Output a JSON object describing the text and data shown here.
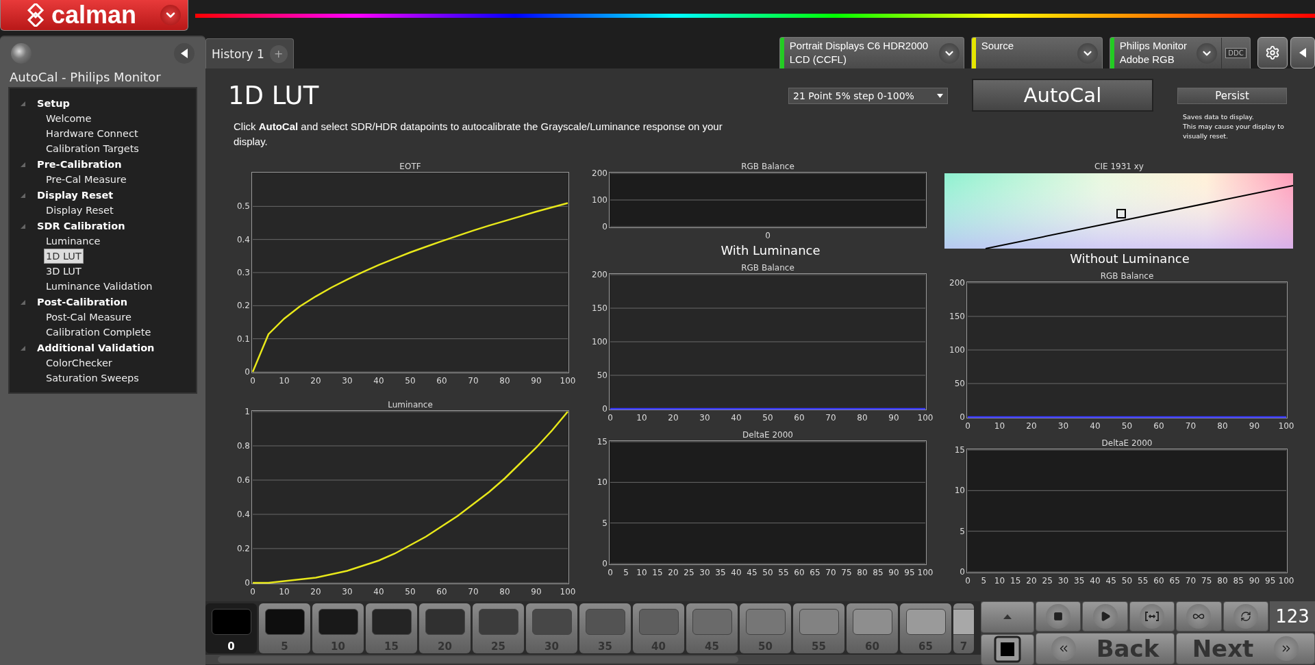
{
  "app": {
    "logo_text": "calman"
  },
  "sidebar": {
    "title": "AutoCal - Philips Monitor",
    "tree": [
      {
        "label": "Setup",
        "expanded": true,
        "children": [
          {
            "label": "Welcome",
            "selected": false
          },
          {
            "label": "Hardware Connect",
            "selected": false
          },
          {
            "label": "Calibration Targets",
            "selected": false
          }
        ]
      },
      {
        "label": "Pre-Calibration",
        "expanded": true,
        "children": [
          {
            "label": "Pre-Cal Measure",
            "selected": false
          }
        ]
      },
      {
        "label": "Display Reset",
        "expanded": true,
        "children": [
          {
            "label": "Display Reset",
            "selected": false
          }
        ]
      },
      {
        "label": "SDR Calibration",
        "expanded": true,
        "children": [
          {
            "label": "Luminance",
            "selected": false
          },
          {
            "label": "1D LUT",
            "selected": true
          },
          {
            "label": "3D LUT",
            "selected": false
          },
          {
            "label": "Luminance Validation",
            "selected": false
          }
        ]
      },
      {
        "label": "Post-Calibration",
        "expanded": true,
        "children": [
          {
            "label": "Post-Cal Measure",
            "selected": false
          },
          {
            "label": "Calibration Complete",
            "selected": false
          }
        ]
      },
      {
        "label": "Additional Validation",
        "expanded": true,
        "children": [
          {
            "label": "ColorChecker",
            "selected": false
          },
          {
            "label": "Saturation Sweeps",
            "selected": false
          }
        ]
      }
    ]
  },
  "tabs": [
    {
      "label": "History 1",
      "selected": true
    }
  ],
  "add_tab": "+",
  "devices": [
    {
      "line1": "Portrait Displays C6 HDR2000",
      "line2": "LCD (CCFL)",
      "color": "#22cc22"
    },
    {
      "line1": "Source",
      "color": "#e6e600"
    },
    {
      "line1": "Philips Monitor",
      "line2": "Adobe RGB",
      "color": "#22cc22"
    }
  ],
  "ddc_label": "DDC",
  "page": {
    "title": "1D LUT",
    "description": "Click **AutoCal** and select SDR/HDR datapoints to autocalibrate the Grayscale/Luminance response on your display.",
    "datapoints_select": "21 Point 5% step 0-100%",
    "autocal_button": "AutoCal",
    "persist_button": "Persist",
    "persist_note": [
      "Saves data to display.",
      "This may cause your display to visually reset."
    ]
  },
  "charts": {
    "eotf": {
      "chart_data": {
        "type": "line",
        "title": "EOTF",
        "x": [
          0,
          5,
          10,
          15,
          20,
          25,
          30,
          35,
          40,
          45,
          50,
          55,
          60,
          65,
          70,
          75,
          80,
          85,
          90,
          95,
          100
        ],
        "xlim": [
          0,
          100
        ],
        "ylim": [
          0,
          0.6
        ],
        "grid": true,
        "xticks": [
          0,
          10,
          20,
          30,
          40,
          50,
          60,
          70,
          80,
          90,
          100
        ],
        "yticks": [
          0,
          0.1,
          0.2,
          0.3,
          0.4,
          0.5
        ],
        "series": [
          {
            "color": "#e8e81a",
            "values": [
              0,
              0.114,
              0.161,
              0.198,
              0.228,
              0.255,
              0.279,
              0.302,
              0.323,
              0.342,
              0.361,
              0.378,
              0.395,
              0.411,
              0.427,
              0.442,
              0.456,
              0.47,
              0.484,
              0.497,
              0.51
            ]
          }
        ]
      }
    },
    "luminance": {
      "chart_data": {
        "type": "line",
        "title": "Luminance",
        "x": [
          0,
          5,
          10,
          15,
          20,
          25,
          30,
          35,
          40,
          45,
          50,
          55,
          60,
          65,
          70,
          75,
          80,
          85,
          90,
          95,
          100
        ],
        "xlim": [
          0,
          100
        ],
        "ylim": [
          0,
          1
        ],
        "grid": true,
        "xticks": [
          0,
          10,
          20,
          30,
          40,
          50,
          60,
          70,
          80,
          90,
          100
        ],
        "yticks": [
          0,
          0.2,
          0.4,
          0.6,
          0.8,
          1
        ],
        "series": [
          {
            "color": "#e8e81a",
            "values": [
              0,
              0,
              0.01,
              0.02,
              0.03,
              0.05,
              0.07,
              0.1,
              0.13,
              0.17,
              0.22,
              0.27,
              0.33,
              0.39,
              0.46,
              0.53,
              0.61,
              0.7,
              0.79,
              0.89,
              1
            ]
          }
        ]
      }
    },
    "with_luminance": {
      "rgb_summary": {
        "chart_data": {
          "type": "bar",
          "title": "RGB Balance",
          "categories": [
            "0"
          ],
          "ylim": [
            0,
            200
          ],
          "yticks": [
            0,
            100,
            200
          ],
          "grid": true
        }
      },
      "heading": "With Luminance",
      "rgb_balance": {
        "chart_data": {
          "type": "line",
          "title": "RGB Balance",
          "x": [
            0,
            100
          ],
          "xlim": [
            0,
            100
          ],
          "ylim": [
            0,
            200
          ],
          "grid": true,
          "xticks": [
            0,
            10,
            20,
            30,
            40,
            50,
            60,
            70,
            80,
            90,
            100
          ],
          "yticks": [
            0,
            50,
            100,
            150,
            200
          ],
          "series": [
            {
              "color": "#3a3aff",
              "values": [
                0,
                0
              ]
            }
          ]
        }
      },
      "deltae": {
        "chart_data": {
          "type": "bar",
          "title": "DeltaE 2000",
          "xlim": [
            0,
            100
          ],
          "ylim": [
            0,
            15
          ],
          "grid": true,
          "xticks": [
            0,
            5,
            10,
            15,
            20,
            25,
            30,
            35,
            40,
            45,
            50,
            55,
            60,
            65,
            70,
            75,
            80,
            85,
            90,
            95,
            100
          ],
          "yticks": [
            0,
            5,
            10,
            15
          ]
        }
      }
    },
    "without_luminance": {
      "cie_title": "CIE 1931 xy",
      "heading": "Without Luminance",
      "rgb_balance": {
        "chart_data": {
          "type": "line",
          "title": "RGB Balance",
          "x": [
            0,
            100
          ],
          "xlim": [
            0,
            100
          ],
          "ylim": [
            0,
            200
          ],
          "grid": true,
          "xticks": [
            0,
            10,
            20,
            30,
            40,
            50,
            60,
            70,
            80,
            90,
            100
          ],
          "yticks": [
            0,
            50,
            100,
            150,
            200
          ],
          "series": [
            {
              "color": "#3a3aff",
              "values": [
                0,
                0
              ]
            }
          ]
        }
      },
      "deltae": {
        "chart_data": {
          "type": "bar",
          "title": "DeltaE 2000",
          "xlim": [
            0,
            100
          ],
          "ylim": [
            0,
            15
          ],
          "grid": true,
          "xticks": [
            0,
            5,
            10,
            15,
            20,
            25,
            30,
            35,
            40,
            45,
            50,
            55,
            60,
            65,
            70,
            75,
            80,
            85,
            90,
            95,
            100
          ],
          "yticks": [
            0,
            5,
            10,
            15
          ]
        }
      }
    }
  },
  "swatches": [
    {
      "label": "0",
      "color": "#000000",
      "selected": true
    },
    {
      "label": "5",
      "color": "#0e0e0e",
      "selected": false
    },
    {
      "label": "10",
      "color": "#191919",
      "selected": false
    },
    {
      "label": "15",
      "color": "#242424",
      "selected": false
    },
    {
      "label": "20",
      "color": "#303030",
      "selected": false
    },
    {
      "label": "25",
      "color": "#3c3c3c",
      "selected": false
    },
    {
      "label": "30",
      "color": "#474747",
      "selected": false
    },
    {
      "label": "35",
      "color": "#535353",
      "selected": false
    },
    {
      "label": "40",
      "color": "#5e5e5e",
      "selected": false
    },
    {
      "label": "45",
      "color": "#6a6a6a",
      "selected": false
    },
    {
      "label": "50",
      "color": "#767676",
      "selected": false
    },
    {
      "label": "55",
      "color": "#828282",
      "selected": false
    },
    {
      "label": "60",
      "color": "#8e8e8e",
      "selected": false
    },
    {
      "label": "65",
      "color": "#9a9a9a",
      "selected": false
    },
    {
      "label": "7",
      "color": "#a8a8a8",
      "selected": false
    }
  ],
  "controls": {
    "counter": "123",
    "back": "Back",
    "next": "Next"
  }
}
